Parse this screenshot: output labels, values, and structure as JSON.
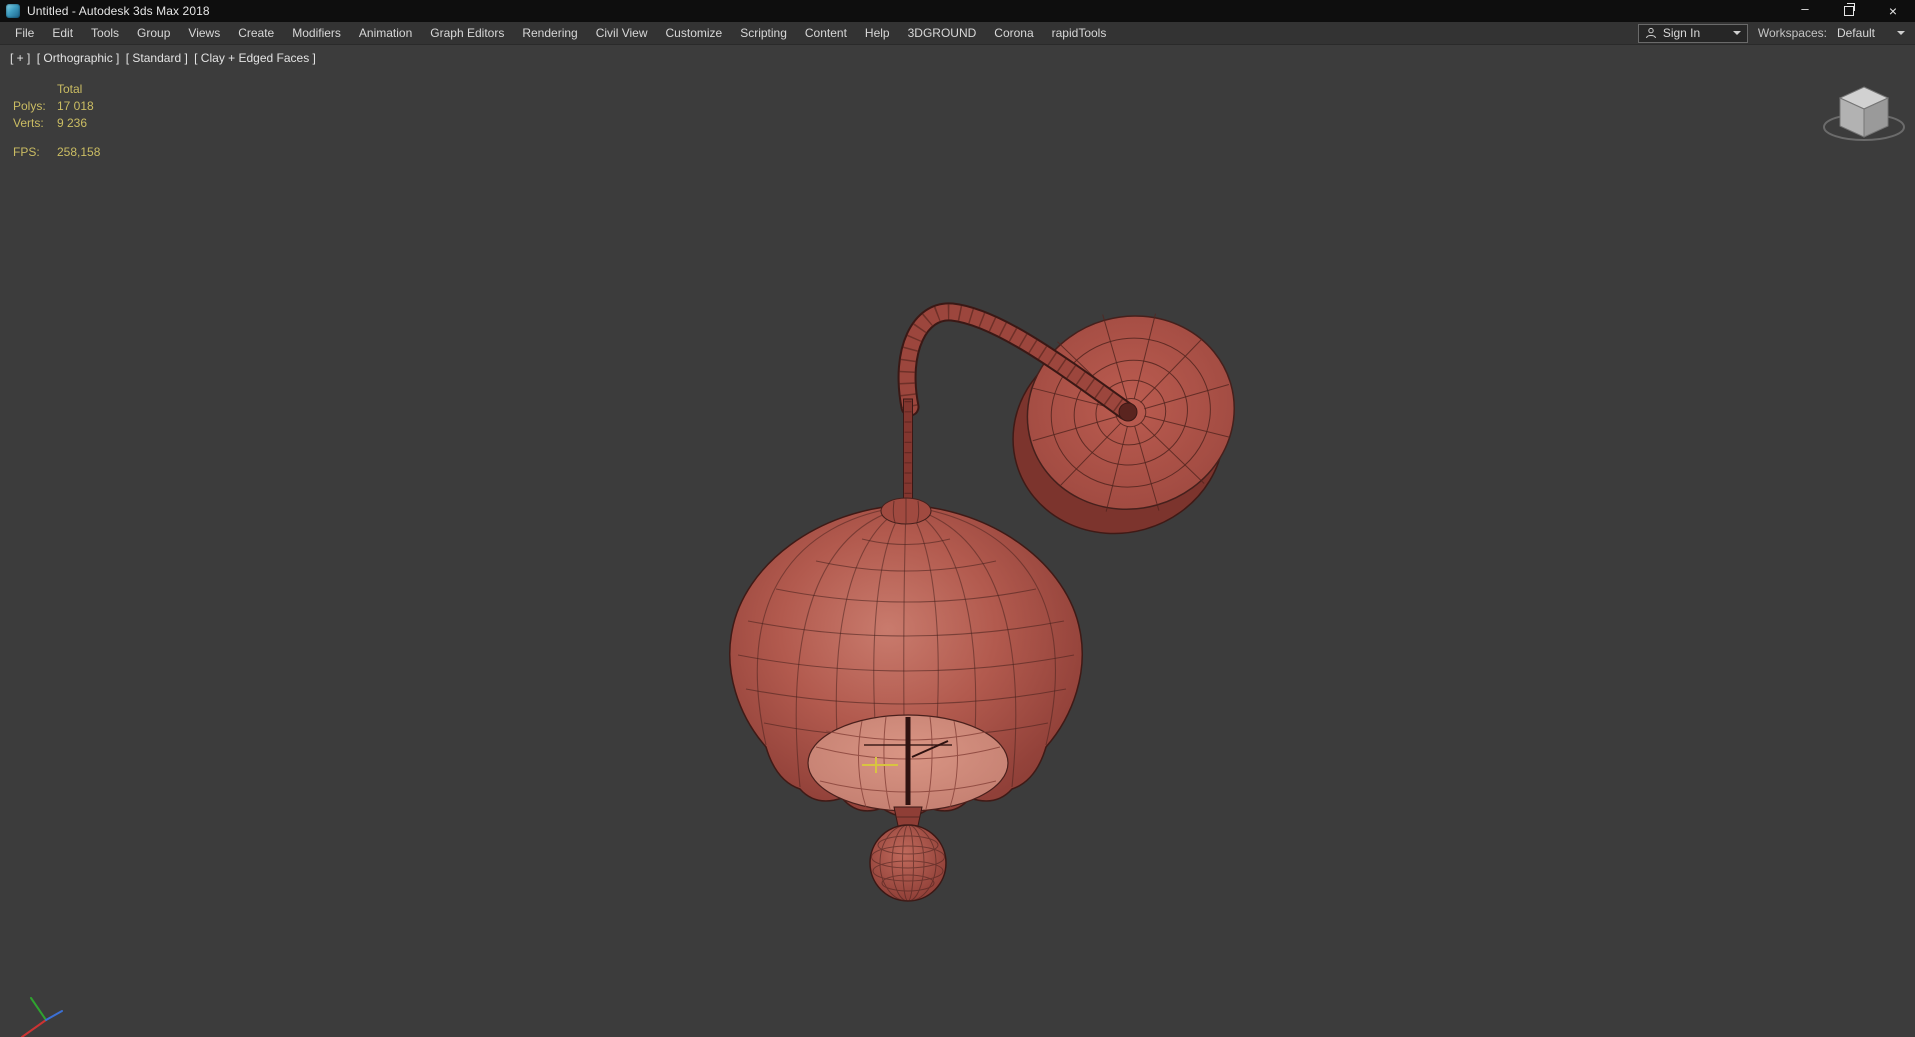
{
  "window": {
    "title": "Untitled - Autodesk 3ds Max 2018",
    "controls": {
      "minimize_glyph": "–",
      "close_glyph": "×"
    }
  },
  "menu": {
    "items": [
      "File",
      "Edit",
      "Tools",
      "Group",
      "Views",
      "Create",
      "Modifiers",
      "Animation",
      "Graph Editors",
      "Rendering",
      "Civil View",
      "Customize",
      "Scripting",
      "Content",
      "Help",
      "3DGROUND",
      "Corona",
      "rapidTools"
    ]
  },
  "account": {
    "sign_in_label": "Sign In"
  },
  "workspaces": {
    "label": "Workspaces:",
    "value": "Default"
  },
  "viewport": {
    "label_segments": [
      "[ + ]",
      "[ Orthographic ]",
      "[ Standard ]",
      "[ Clay + Edged Faces ]"
    ],
    "stats": {
      "total_label": "Total",
      "polys_label": "Polys:",
      "polys_value": "17 018",
      "verts_label": "Verts:",
      "verts_value": "9 236",
      "fps_label": "FPS:",
      "fps_value": "258,158"
    }
  },
  "colors": {
    "viewport_background": "#3c3c3c",
    "stats_text": "#cbbd63",
    "model_red": "#a84c42",
    "wire_edge": "#3f1a16"
  }
}
